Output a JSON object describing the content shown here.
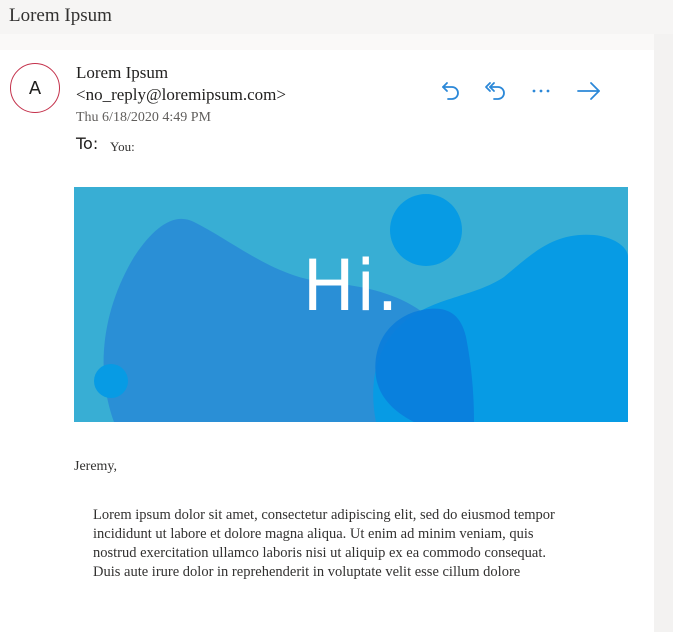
{
  "header": {
    "subject": "Lorem Ipsum"
  },
  "message": {
    "avatar_initial": "A",
    "sender_name": "Lorem Ipsum",
    "sender_email": "<no_reply@loremipsum.com>",
    "date": "Thu 6/18/2020 4:49 PM",
    "to_label": "To:",
    "to_value": "You:",
    "actions": [
      {
        "name": "reply-icon"
      },
      {
        "name": "reply-all-icon"
      },
      {
        "name": "more-options-icon"
      },
      {
        "name": "forward-icon"
      }
    ],
    "accent_color": "#2b88d8",
    "banner": {
      "text": "Hi.",
      "background": "#38aed4",
      "blob_colors": [
        "#2a8fd6",
        "#079be4",
        "#0a7ddb"
      ]
    },
    "greeting": "Jeremy,",
    "body_lines": [
      "Lorem ipsum dolor sit amet, consectetur adipiscing elit, sed do eiusmod tempor",
      "incididunt ut labore et dolore magna aliqua. Ut enim ad minim veniam, quis",
      "nostrud exercitation ullamco laboris nisi ut aliquip ex ea commodo consequat.",
      "Duis aute irure dolor in reprehenderit in voluptate velit esse cillum dolore"
    ]
  }
}
